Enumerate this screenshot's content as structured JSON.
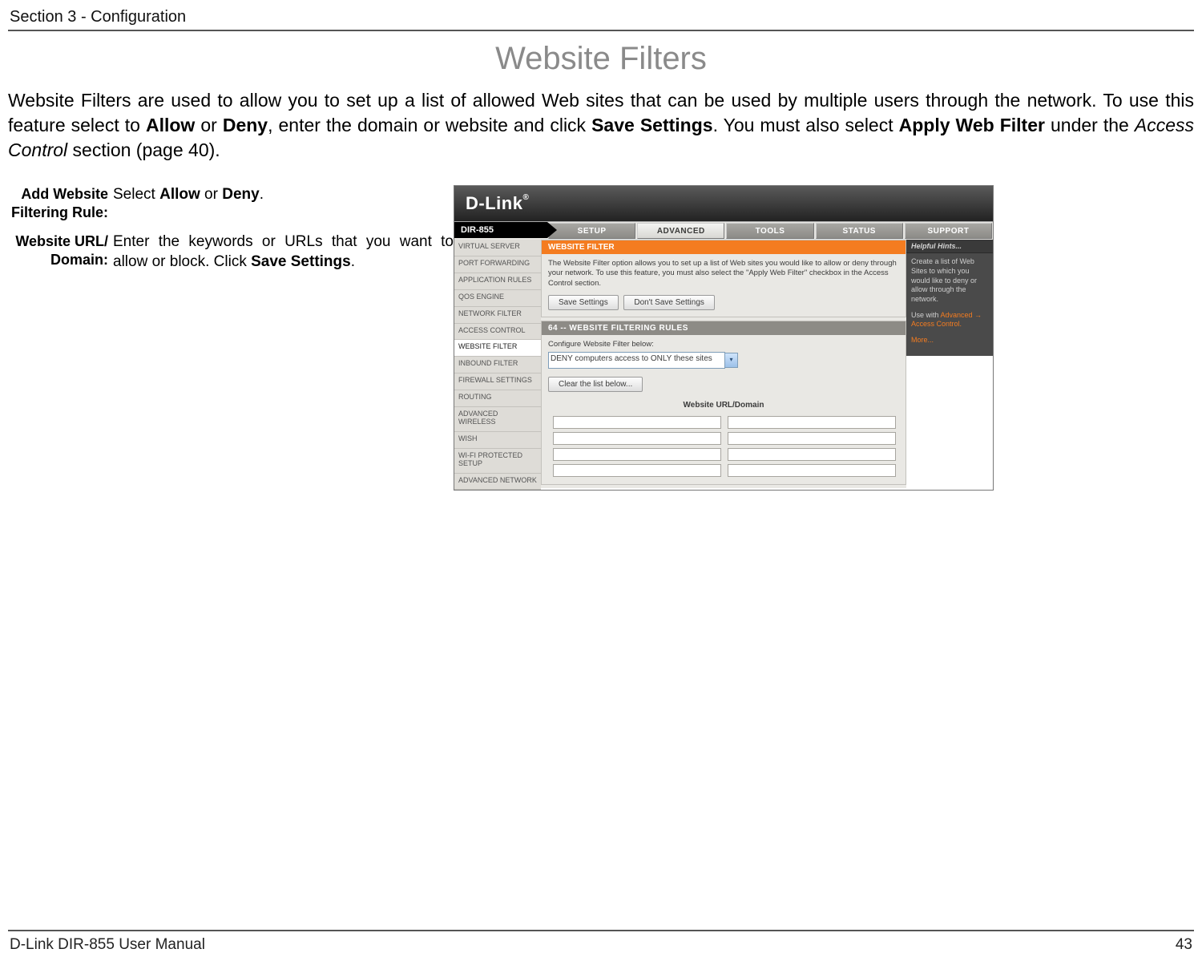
{
  "section_header": "Section 3 - Configuration",
  "page_title": "Website Filters",
  "intro_parts": {
    "p1": "Website Filters are used to allow you to set up a list of allowed Web sites that can be used by multiple users through the network. To use this feature select to ",
    "b1": "Allow",
    "p2": " or ",
    "b2": "Deny",
    "p3": ", enter the domain or website and click ",
    "b3": "Save Settings",
    "p4": ". You must also select ",
    "b4": "Apply Web Filter",
    "p5": " under the ",
    "i1": "Access Control",
    "p6": " section (page 40)."
  },
  "defs": [
    {
      "label_line1": "Add Website",
      "label_line2": "Filtering Rule:",
      "body_pre": "Select ",
      "body_b1": "Allow",
      "body_mid": " or ",
      "body_b2": "Deny",
      "body_post": "."
    },
    {
      "label_line1": "Website URL/",
      "label_line2": "Domain:",
      "body_pre": "Enter the keywords or URLs that you want to allow or block. Click ",
      "body_b1": "Save Settings",
      "body_post": "."
    }
  ],
  "screenshot": {
    "logo": "D-Link",
    "model": "DIR-855",
    "tabs": [
      "SETUP",
      "ADVANCED",
      "TOOLS",
      "STATUS",
      "SUPPORT"
    ],
    "active_tab_index": 1,
    "sidebar": [
      "VIRTUAL SERVER",
      "PORT FORWARDING",
      "APPLICATION RULES",
      "QOS ENGINE",
      "NETWORK FILTER",
      "ACCESS CONTROL",
      "WEBSITE FILTER",
      "INBOUND FILTER",
      "FIREWALL SETTINGS",
      "ROUTING",
      "ADVANCED WIRELESS",
      "WISH",
      "WI-FI PROTECTED SETUP",
      "ADVANCED NETWORK"
    ],
    "active_side_index": 6,
    "panel1": {
      "header": "WEBSITE FILTER",
      "text": "The Website Filter option allows you to set up a list of Web sites you would like to allow or deny through your network. To use this feature, you must also select the \"Apply Web Filter\" checkbox in the Access Control section.",
      "btn_save": "Save Settings",
      "btn_dont": "Don't Save Settings"
    },
    "panel2": {
      "header": "64 -- WEBSITE FILTERING RULES",
      "configure_label": "Configure Website Filter below:",
      "select_value": "DENY computers access to ONLY these sites",
      "btn_clear": "Clear the list below...",
      "table_header": "Website URL/Domain"
    },
    "hints": {
      "header": "Helpful Hints...",
      "body1": "Create a list of Web Sites to which you would like to deny or allow through the network.",
      "body2_pre": "Use with ",
      "body2_link": "Advanced → Access Control.",
      "more": "More..."
    }
  },
  "footer_left": "D-Link DIR-855 User Manual",
  "footer_right": "43"
}
